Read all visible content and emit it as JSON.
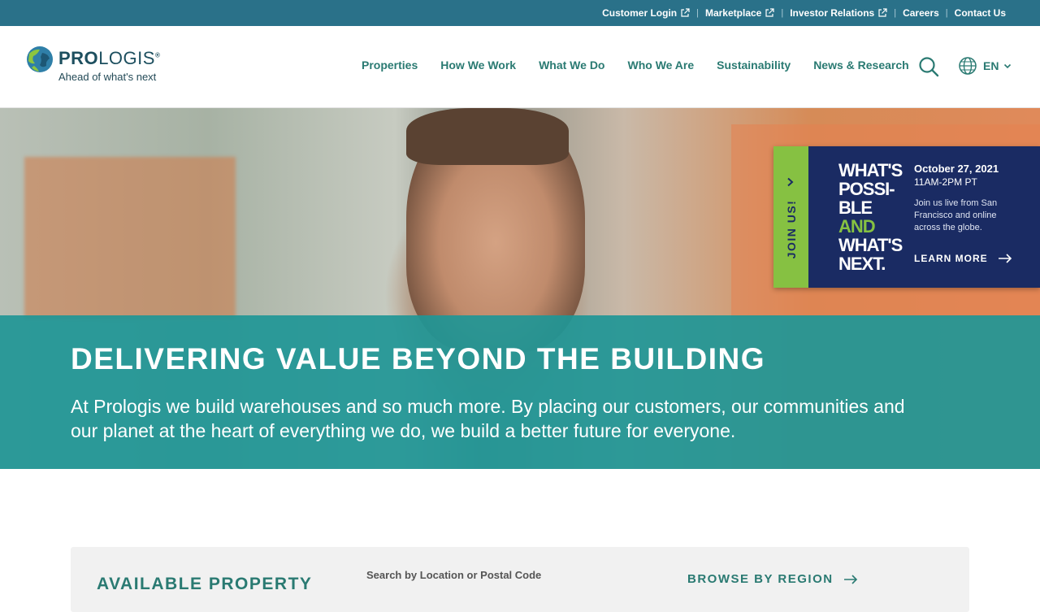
{
  "utility": {
    "customer_login": "Customer Login",
    "marketplace": "Marketplace",
    "investor_relations": "Investor Relations",
    "careers": "Careers",
    "contact_us": "Contact Us",
    "separator": "|"
  },
  "brand": {
    "name_bold": "PRO",
    "name_light": "LOGIS",
    "registered": "®",
    "tagline": "Ahead of what's next",
    "logo_icon": "globe-icon"
  },
  "nav": {
    "items": [
      {
        "label": "Properties"
      },
      {
        "label": "How We Work"
      },
      {
        "label": "What We Do"
      },
      {
        "label": "Who We Are"
      },
      {
        "label": "Sustainability"
      },
      {
        "label": "News & Research"
      }
    ],
    "search_icon": "search-icon",
    "language_icon": "globe-icon",
    "language": "EN"
  },
  "hero": {
    "title": "DELIVERING VALUE BEYOND THE BUILDING",
    "text": "At Prologis we build warehouses and so much more. By placing our customers, our communities and our planet at the heart of everything we do, we build a better future for everyone."
  },
  "promo": {
    "tab_label": "JOIN US!",
    "art_lines": [
      "WHAT'S",
      "POSSI-",
      "BLE",
      "AND",
      "WHAT'S",
      "NEXT."
    ],
    "date": "October 27, 2021",
    "time": "11AM-2PM PT",
    "description": "Join us live from San Francisco and online across the globe.",
    "cta": "LEARN MORE"
  },
  "search_panel": {
    "title": "AVAILABLE PROPERTY",
    "location_label": "Search by Location or Postal Code",
    "browse": "BROWSE BY REGION"
  },
  "colors": {
    "utility_bar": "#2a7189",
    "nav_text": "#2a7a72",
    "hero_overlay": "#209696",
    "promo_bg": "#1a2b63",
    "promo_tab": "#86c142"
  }
}
